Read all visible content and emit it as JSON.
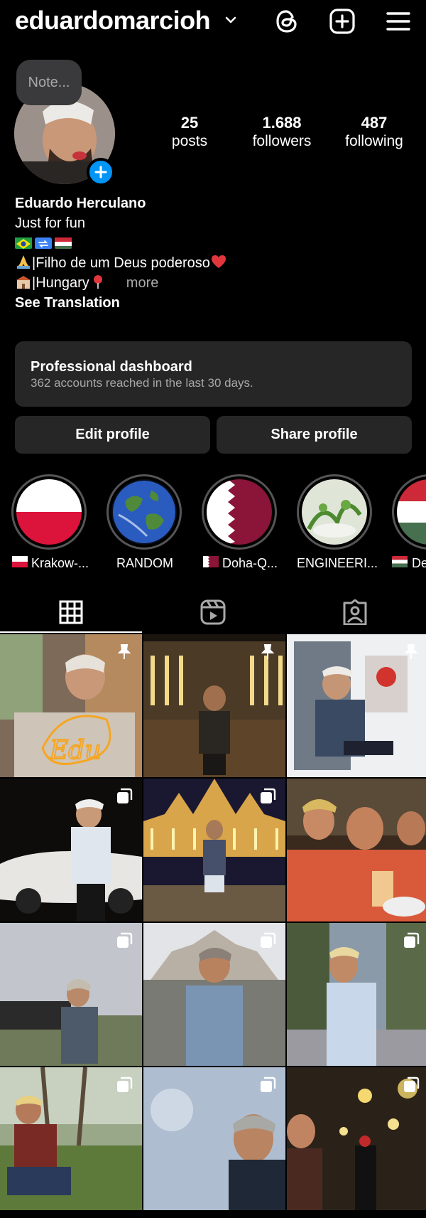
{
  "header": {
    "username": "eduardomarcioh",
    "icons": [
      "chevron-down-icon",
      "threads-icon",
      "create-post-icon",
      "menu-icon"
    ]
  },
  "note": {
    "placeholder": "Note..."
  },
  "stats": [
    {
      "value": "25",
      "label": "posts"
    },
    {
      "value": "1.688",
      "label": "followers"
    },
    {
      "value": "487",
      "label": "following"
    }
  ],
  "bio": {
    "name": "Eduardo Herculano",
    "line1": "Just for fun",
    "line3": "|Filho de um Deus poderoso",
    "line4": "|Hungary",
    "more": "more",
    "see_translation": "See Translation"
  },
  "dashboard": {
    "title": "Professional dashboard",
    "subtitle": "362 accounts reached in the last 30 days."
  },
  "buttons": {
    "edit": "Edit profile",
    "share": "Share profile"
  },
  "highlights": [
    {
      "label": "Krakow-..."
    },
    {
      "label": "RANDOM"
    },
    {
      "label": "Doha-Q..."
    },
    {
      "label": "ENGINEERI..."
    },
    {
      "label": "De"
    }
  ],
  "tabs": [
    "grid-tab",
    "reels-tab",
    "tagged-tab"
  ],
  "colors": {
    "accent": "#0095f6",
    "background": "#000000",
    "surface": "#262626",
    "secondary_text": "#a8a8a8"
  }
}
